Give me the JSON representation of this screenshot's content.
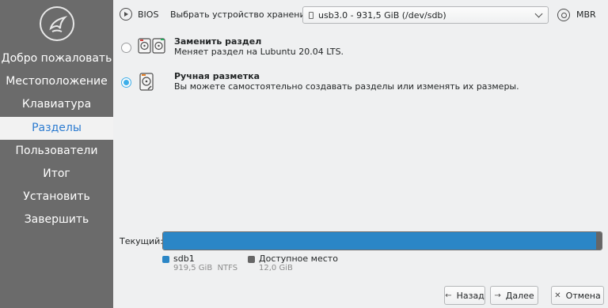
{
  "sidebar": {
    "items": [
      {
        "label": "Добро пожаловать",
        "active": false
      },
      {
        "label": "Местоположение",
        "active": false
      },
      {
        "label": "Клавиатура",
        "active": false
      },
      {
        "label": "Разделы",
        "active": true
      },
      {
        "label": "Пользователи",
        "active": false
      },
      {
        "label": "Итог",
        "active": false
      },
      {
        "label": "Установить",
        "active": false
      },
      {
        "label": "Завершить",
        "active": false
      }
    ]
  },
  "topbar": {
    "bios_label": "BIOS",
    "storage_label": "Выбрать устройство хранения:",
    "storage_value": "usb3.0 - 931,5 GiB (/dev/sdb)",
    "mbr_label": "MBR"
  },
  "options": [
    {
      "title": "Заменить раздел",
      "desc": "Меняет раздел на Lubuntu 20.04 LTS.",
      "selected": false,
      "icon": "replace-partition-icon"
    },
    {
      "title": "Ручная разметка",
      "desc": "Вы можете самостоятельно создавать разделы или изменять их размеры.",
      "selected": true,
      "icon": "manual-partition-icon"
    }
  ],
  "partition": {
    "current_label": "Текущий:",
    "segments": [
      {
        "name": "sdb1",
        "size": "919,5 GiB",
        "fs": "NTFS",
        "color": "#2b86c6",
        "fraction": 0.987
      },
      {
        "name": "Доступное место",
        "size": "12,0 GiB",
        "fs": "",
        "color": "#666666",
        "fraction": 0.013
      }
    ]
  },
  "buttons": {
    "back": "Назад",
    "next": "Далее",
    "cancel": "Отмена"
  },
  "colors": {
    "sidebar_bg": "#6b6b6b",
    "active_item_text": "#2c7bd0",
    "accent": "#3daee9"
  }
}
